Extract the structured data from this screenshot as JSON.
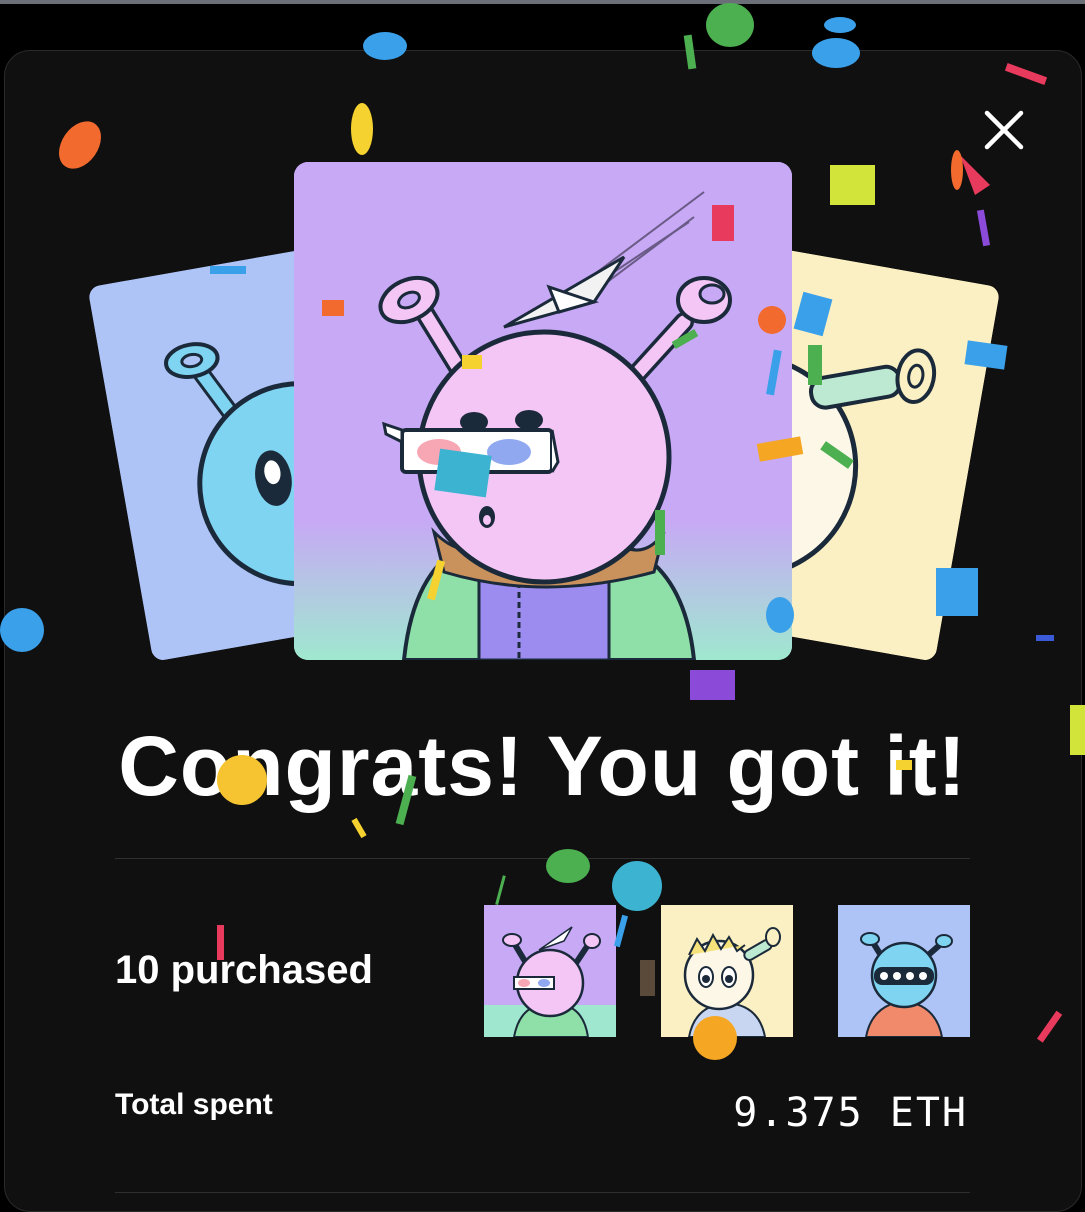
{
  "modal": {
    "title": "Congrats! You got it!",
    "purchased_label": "10 purchased",
    "total_spent_label": "Total spent",
    "total_spent_value": "9.375 ETH"
  },
  "colors": {
    "background": "#101010",
    "card_purple": "#c7a9f5",
    "card_blue": "#aec4f7",
    "card_yellow": "#fbf0c3",
    "character_pink": "#f3c6f6",
    "character_blue": "#7fd4f2"
  },
  "icons": {
    "close": "close-icon"
  }
}
